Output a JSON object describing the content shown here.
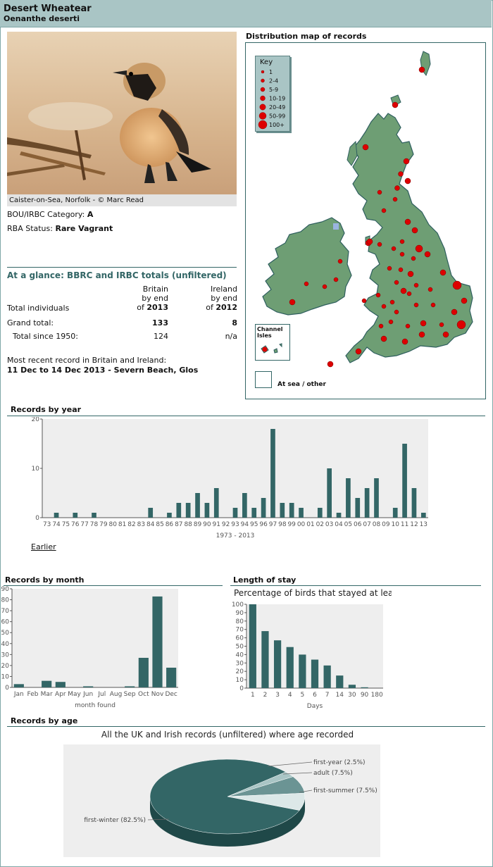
{
  "header": {
    "common_name": "Desert Wheatear",
    "scientific_name": "Oenanthe deserti"
  },
  "photo": {
    "caption": "Caister-on-Sea, Norfolk - © Marc Read"
  },
  "status": {
    "bou_label": "BOU/IRBC Category: ",
    "bou_value": "A",
    "rba_label": "RBA Status: ",
    "rba_value": "Rare Vagrant"
  },
  "glance": {
    "title": "At a glance: BBRC and IRBC totals (unfiltered)",
    "britain_head": [
      "Britain",
      "by end",
      "of "
    ],
    "britain_year": "2013",
    "ireland_head": [
      "Ireland",
      "by end",
      "of "
    ],
    "ireland_year": "2012",
    "total_individuals": "Total individuals",
    "grand_total_label": "Grand total:",
    "grand_total_britain": "133",
    "grand_total_ireland": "8",
    "since_label": "Total since 1950:",
    "since_britain": "124",
    "since_ireland": "n/a",
    "recent_label": "Most recent record in Britain and Ireland:",
    "recent_value": "11 Dec to 14 Dec 2013 - Severn Beach, Glos"
  },
  "map": {
    "title": "Distribution map of records",
    "key_title": "Key",
    "key_items": [
      "1",
      "2-4",
      "5-9",
      "10-19",
      "20-49",
      "50-99",
      "100+"
    ],
    "channel_label": "Channel Isles",
    "sea_label": "At sea / other",
    "land_color": "#6e9e74",
    "dot_color": "#dd0000"
  },
  "sections": {
    "by_year": "Records by year",
    "earlier_link": "Earlier",
    "by_month": "Records by month",
    "stay": "Length of stay",
    "by_age": "Records by age"
  },
  "colors": {
    "bar": "#336666",
    "plot_bg": "#eeeeee",
    "accent": "#336666"
  },
  "chart_data": [
    {
      "type": "bar",
      "id": "year",
      "categories": [
        "73",
        "74",
        "75",
        "76",
        "77",
        "78",
        "79",
        "80",
        "81",
        "82",
        "83",
        "84",
        "85",
        "86",
        "87",
        "88",
        "89",
        "90",
        "91",
        "92",
        "93",
        "94",
        "95",
        "96",
        "97",
        "98",
        "99",
        "00",
        "01",
        "02",
        "03",
        "04",
        "05",
        "06",
        "07",
        "08",
        "09",
        "10",
        "11",
        "12",
        "13"
      ],
      "values": [
        0,
        1,
        0,
        1,
        0,
        1,
        0,
        0,
        0,
        0,
        0,
        2,
        0,
        1,
        3,
        3,
        5,
        3,
        6,
        0,
        2,
        5,
        2,
        4,
        18,
        3,
        3,
        2,
        0,
        2,
        10,
        1,
        8,
        4,
        6,
        8,
        0,
        2,
        15,
        6,
        1
      ],
      "xlabel": "1973 - 2013",
      "ylim": [
        0,
        20
      ],
      "yticks": [
        0,
        10,
        20
      ]
    },
    {
      "type": "bar",
      "id": "month",
      "categories": [
        "Jan",
        "Feb",
        "Mar",
        "Apr",
        "May",
        "Jun",
        "Jul",
        "Aug",
        "Sep",
        "Oct",
        "Nov",
        "Dec"
      ],
      "values": [
        3,
        0,
        6,
        5,
        0,
        1,
        0,
        0,
        1,
        27,
        83,
        18
      ],
      "xlabel": "month found",
      "ylim": [
        0,
        90
      ],
      "yticks": [
        0,
        10,
        20,
        30,
        40,
        50,
        60,
        70,
        80,
        90
      ]
    },
    {
      "type": "bar",
      "id": "stay",
      "title": "Percentage of birds that stayed at least...",
      "categories": [
        "1",
        "2",
        "3",
        "4",
        "5",
        "6",
        "7",
        "14",
        "30",
        "90",
        "180"
      ],
      "values": [
        100,
        68,
        57,
        49,
        40,
        34,
        27,
        15,
        4,
        1,
        0
      ],
      "xlabel": "Days",
      "ylim": [
        0,
        100
      ],
      "yticks": [
        0,
        10,
        20,
        30,
        40,
        50,
        60,
        70,
        80,
        90,
        100
      ]
    },
    {
      "type": "pie",
      "id": "age",
      "title": "All the UK and Irish records (unfiltered) where age recorded",
      "slices": [
        {
          "label": "first-winter (82.5%)",
          "value": 82.5,
          "color": "#336666"
        },
        {
          "label": "first-year (2.5%)",
          "value": 2.5,
          "color": "#a9c5c5"
        },
        {
          "label": "adult (7.5%)",
          "value": 7.5,
          "color": "#6b9494"
        },
        {
          "label": "first-summer (7.5%)",
          "value": 7.5,
          "color": "#dce8e8"
        }
      ]
    }
  ]
}
